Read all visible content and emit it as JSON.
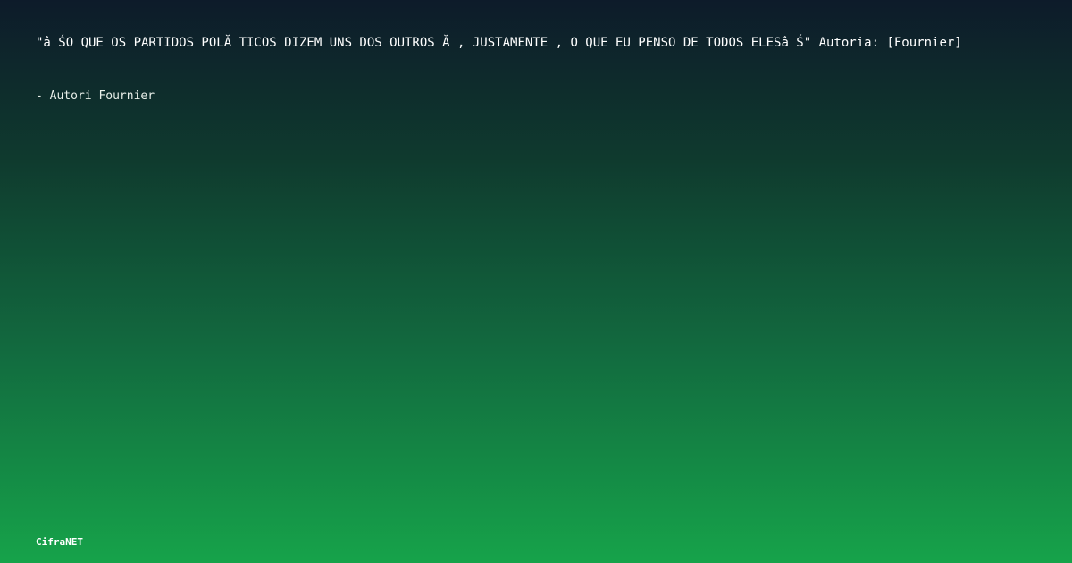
{
  "quote": {
    "text": "\"â ŚO QUE OS PARTIDOS POLĂ TICOS DIZEM UNS DOS OUTROS Ă , JUSTAMENTE , O QUE EU PENSO DE TODOS ELESâ Ś\" Autoria: [Fournier]"
  },
  "author": {
    "line": "- Autori Fournier"
  },
  "brand": {
    "name": "CifraNET"
  },
  "colors": {
    "background_top": "#0d1b2a",
    "background_bottom": "#16a34a",
    "text": "#ffffff"
  }
}
